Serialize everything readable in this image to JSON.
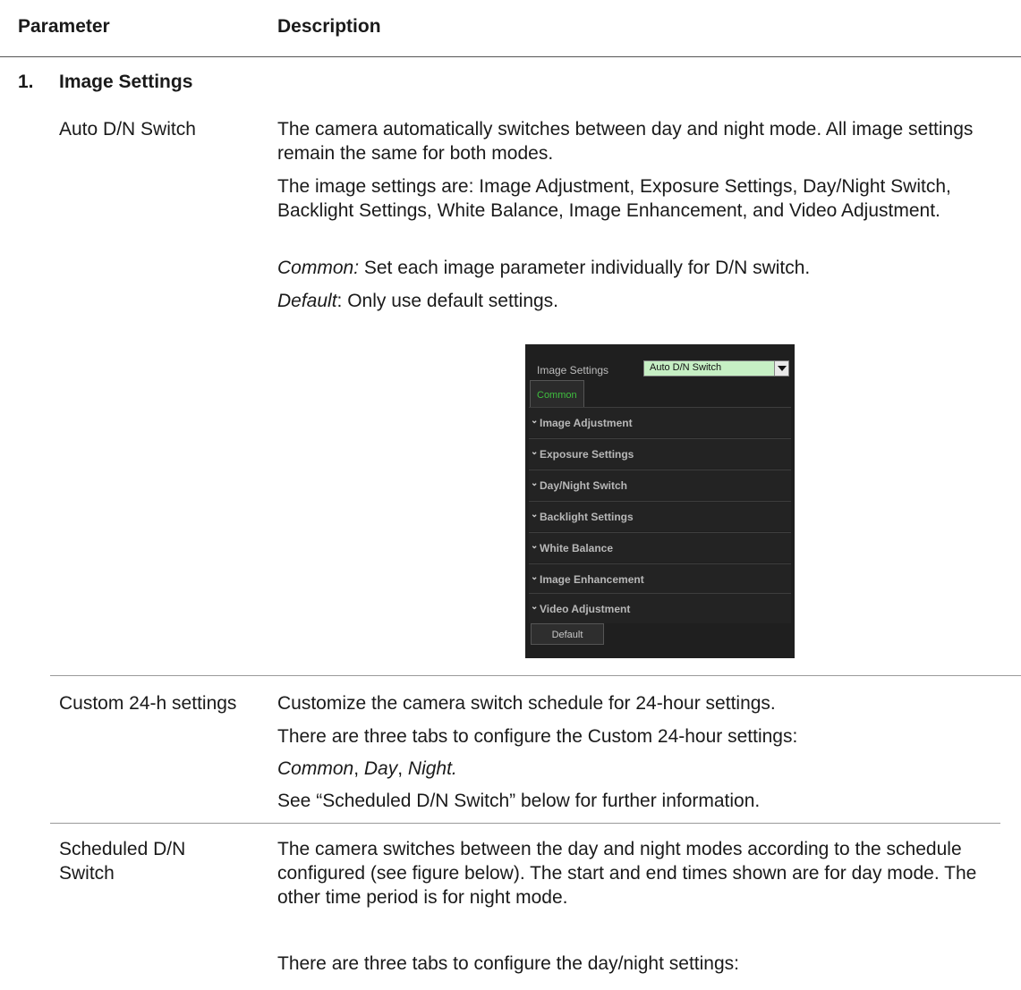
{
  "table": {
    "header": {
      "parameter": "Parameter",
      "description": "Description"
    },
    "section": {
      "number": "1.",
      "title": "Image Settings"
    },
    "rows": [
      {
        "parameter": "Auto D/N Switch",
        "paragraphs": [
          "The camera automatically switches between day and night mode. All image settings remain the same for both modes.",
          "The image settings are: Image Adjustment, Exposure Settings, Day/Night Switch, Backlight Settings, White Balance, Image Enhancement, and Video Adjustment."
        ],
        "common_label": "Common:",
        "common_text": " Set each image parameter individually for D/N switch.",
        "default_label": "Default",
        "default_text": ": Only use default settings."
      },
      {
        "parameter": "Custom 24-h settings",
        "p1": "Customize the camera switch schedule for 24-hour settings.",
        "p2": "There are three tabs to configure the Custom 24-hour settings:",
        "tabs_common": "Common",
        "tabs_sep1": ", ",
        "tabs_day": "Day",
        "tabs_sep2": ", ",
        "tabs_night": "Night.",
        "p4": "See “Scheduled D/N Switch” below for further information."
      },
      {
        "parameter_line1": "Scheduled D/N",
        "parameter_line2": "Switch",
        "p1": "The camera switches between the day and night modes according to the schedule configured (see figure below). The start and end times shown are for day mode. The other time period is for night mode.",
        "p2": "There are three tabs to configure the day/night settings:"
      }
    ]
  },
  "panel": {
    "label": "Image Settings",
    "select_value": "Auto D/N Switch",
    "tab": "Common",
    "sections": [
      "Image Adjustment",
      "Exposure Settings",
      "Day/Night Switch",
      "Backlight Settings",
      "White Balance",
      "Image Enhancement",
      "Video Adjustment"
    ],
    "default_button": "Default",
    "colors": {
      "background": "#1f1f1f",
      "select": "#c6efc4",
      "tab_text": "#3fbf3f"
    }
  }
}
